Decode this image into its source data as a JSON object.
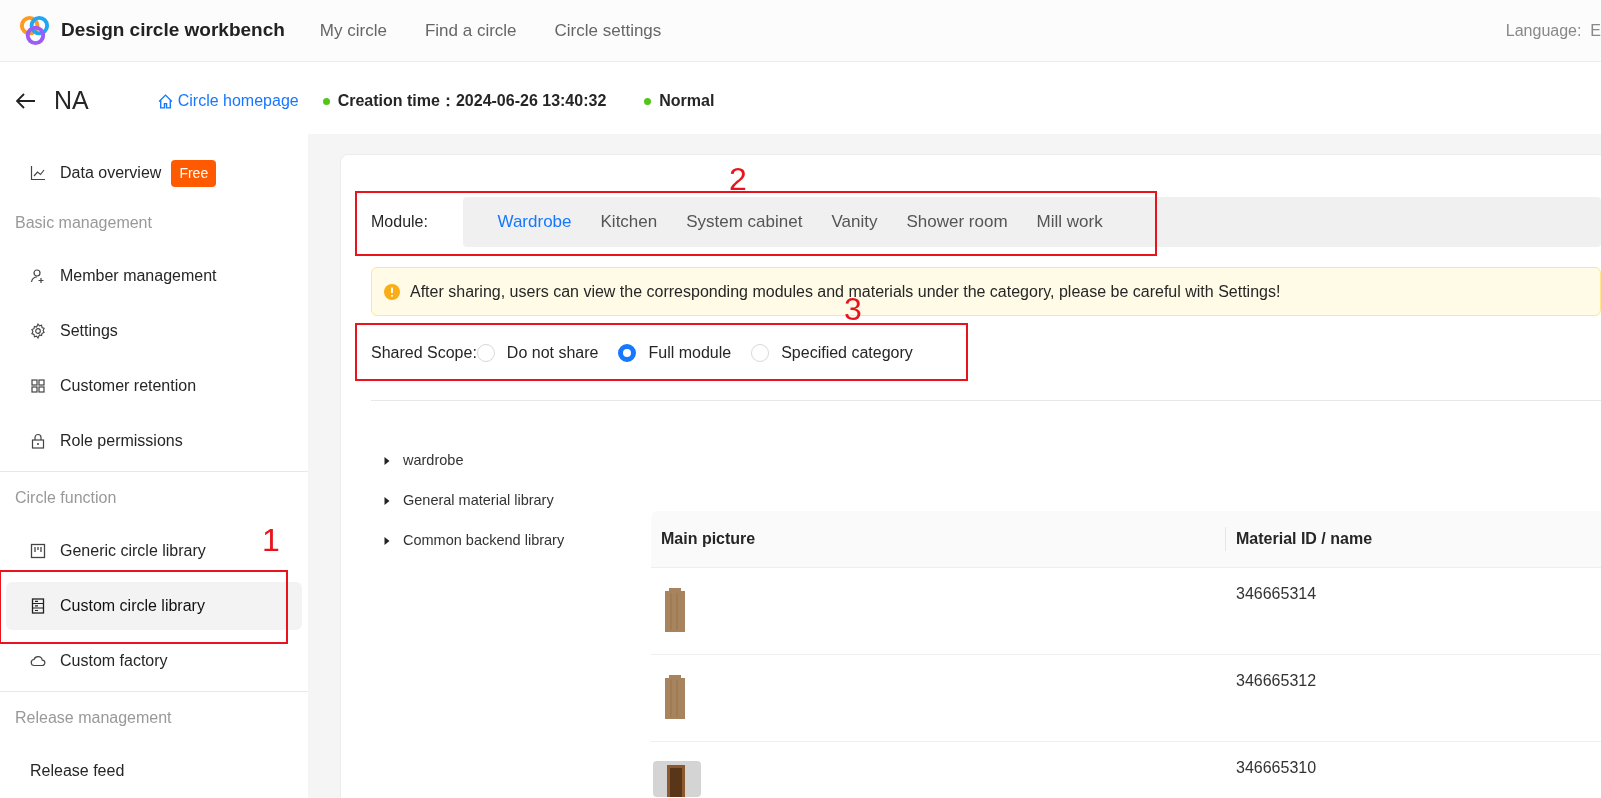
{
  "header": {
    "title": "Design circle workbench",
    "nav": [
      {
        "label": "My circle",
        "selected": false
      },
      {
        "label": "Find a circle",
        "selected": false
      },
      {
        "label": "Circle settings",
        "selected": false
      }
    ],
    "language_label": "Language:",
    "language_value": "E"
  },
  "subheader": {
    "name": "NA",
    "homepage_link": "Circle homepage",
    "creation": {
      "label": "Creation time：",
      "value": "2024-06-26 13:40:32",
      "color": "#52c41a"
    },
    "status": {
      "label": "Normal",
      "color": "#52c41a"
    }
  },
  "sidebar": {
    "items": [
      {
        "kind": "item",
        "label": "Data overview",
        "badge": "Free",
        "selected": false
      },
      {
        "kind": "section",
        "label": "Basic management"
      },
      {
        "kind": "item",
        "label": "Member management",
        "selected": false
      },
      {
        "kind": "item",
        "label": "Settings",
        "selected": false
      },
      {
        "kind": "item",
        "label": "Customer retention",
        "selected": false
      },
      {
        "kind": "item",
        "label": "Role permissions",
        "selected": false
      },
      {
        "kind": "section",
        "label": "Circle function"
      },
      {
        "kind": "item",
        "label": "Generic circle library",
        "selected": false
      },
      {
        "kind": "item",
        "label": "Custom circle library",
        "selected": true,
        "annotation": "1"
      },
      {
        "kind": "item",
        "label": "Custom factory",
        "selected": false
      },
      {
        "kind": "section",
        "label": "Release management"
      },
      {
        "kind": "item",
        "label": "Release feed",
        "selected": false
      }
    ]
  },
  "module": {
    "label": "Module:",
    "annotation": "2",
    "tabs": [
      {
        "label": "Wardrobe",
        "selected": true
      },
      {
        "label": "Kitchen",
        "selected": false
      },
      {
        "label": "System cabinet",
        "selected": false
      },
      {
        "label": "Vanity",
        "selected": false
      },
      {
        "label": "Shower room",
        "selected": false
      },
      {
        "label": "Mill work",
        "selected": false
      }
    ]
  },
  "alert": {
    "text": "After sharing, users can view the corresponding modules and materials under the category, please be careful with Settings!"
  },
  "shared_scope": {
    "label": "Shared Scope:",
    "annotation": "3",
    "options": [
      {
        "label": "Do not share",
        "selected": false
      },
      {
        "label": "Full module",
        "selected": true
      },
      {
        "label": "Specified category",
        "selected": false
      }
    ]
  },
  "tree": [
    {
      "label": "wardrobe",
      "expanded": false
    },
    {
      "label": "General material library",
      "expanded": false
    },
    {
      "label": "Common backend library",
      "expanded": false
    }
  ],
  "table": {
    "columns": [
      "Main picture",
      "Material ID / name"
    ],
    "rows": [
      {
        "kind": "panel",
        "id": "346665314"
      },
      {
        "kind": "panel",
        "id": "346665312"
      },
      {
        "kind": "door",
        "id": "346665310"
      }
    ]
  }
}
